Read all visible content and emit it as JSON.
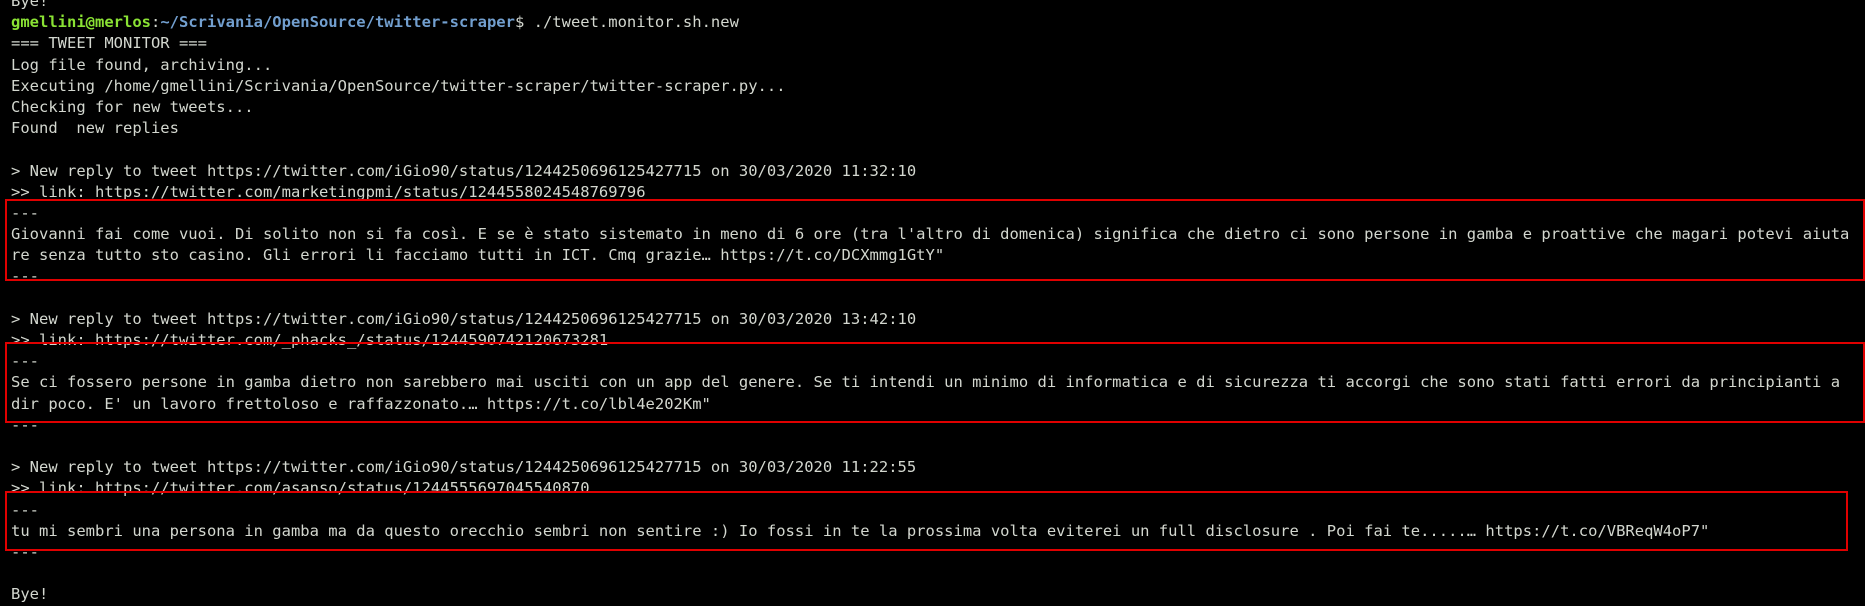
{
  "terminal": {
    "top_partial": "Bye!",
    "prompt": {
      "user_host": "gmellini@merlos",
      "sep": ":",
      "path": "~/Scrivania/OpenSource/twitter-scraper",
      "symbol": "$",
      "command": " ./tweet.monitor.sh.new"
    },
    "header_lines": [
      "=== TWEET MONITOR ===",
      "Log file found, archiving...",
      "Executing /home/gmellini/Scrivania/OpenSource/twitter-scraper/twitter-scraper.py...",
      "Checking for new tweets...",
      "Found  new replies"
    ],
    "replies": [
      {
        "header": "> New reply to tweet https://twitter.com/iGio90/status/1244250696125427715 on 30/03/2020 11:32:10",
        "link": ">> link: https://twitter.com/marketingpmi/status/1244558024548769796",
        "sep_top": "---",
        "text": "Giovanni fai come vuoi. Di solito non si fa così. E se è stato sistemato in meno di 6 ore (tra l'altro di domenica) significa che dietro ci sono persone in gamba e proattive che magari potevi aiutare senza tutto sto casino. Gli errori li facciamo tutti in ICT. Cmq grazie… https://t.co/DCXmmg1GtY\"",
        "sep_bottom": "---"
      },
      {
        "header": "> New reply to tweet https://twitter.com/iGio90/status/1244250696125427715 on 30/03/2020 13:42:10",
        "link": ">> link: https://twitter.com/_phacks_/status/1244590742120673281",
        "sep_top": "---",
        "text": "Se ci fossero persone in gamba dietro non sarebbero mai usciti con un app del genere. Se ti intendi un minimo di informatica e di sicurezza ti accorgi che sono stati fatti errori da principianti a dir poco. E' un lavoro frettoloso e raffazzonato.… https://t.co/lbl4e202Km\"",
        "sep_bottom": "---"
      },
      {
        "header": "> New reply to tweet https://twitter.com/iGio90/status/1244250696125427715 on 30/03/2020 11:22:55",
        "link": ">> link: https://twitter.com/asanso/status/1244555697045540870",
        "sep_top": "---",
        "text": "tu mi sembri una persona in gamba ma da questo orecchio sembri non sentire :) Io fossi in te la prossima volta eviterei un full disclosure . Poi fai te.....… https://t.co/VBReqW4oP7\"",
        "sep_bottom": "---"
      }
    ],
    "footer": "Bye!"
  },
  "colors": {
    "background": "#000000",
    "text": "#d3d7cf",
    "prompt_user": "#8ae234",
    "prompt_path": "#729fcf",
    "highlight": "#e00000"
  }
}
